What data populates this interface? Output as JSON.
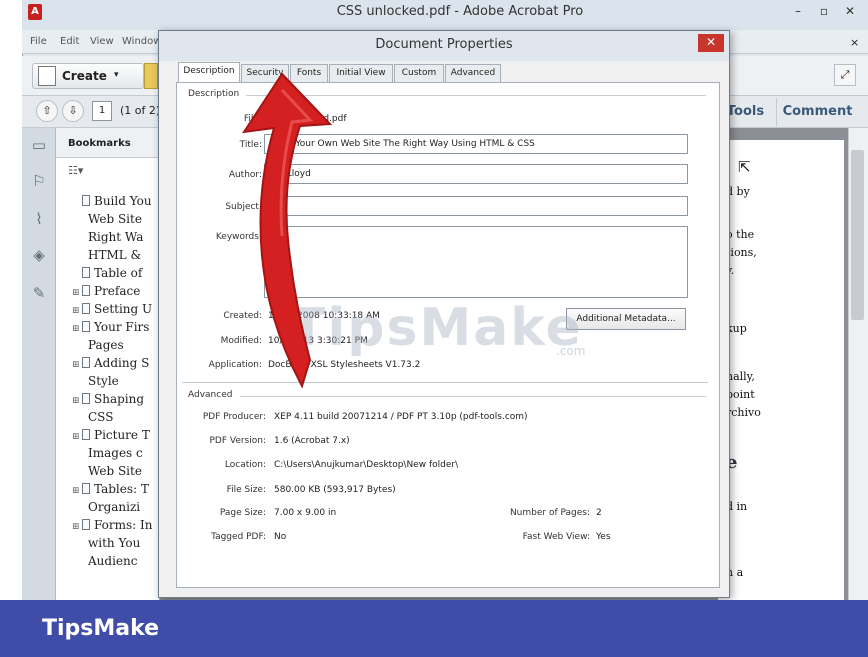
{
  "app": {
    "title": "CSS unlocked.pdf - Adobe Acrobat Pro",
    "menu": [
      "File",
      "Edit",
      "View",
      "Window"
    ],
    "create_label": "Create",
    "page_counter": "(1 of 2)",
    "tools_label": "Tools",
    "comment_label": "Comment",
    "bookmarks_title": "Bookmarks",
    "bookmarks": [
      {
        "label": "Build You",
        "expand": ""
      },
      {
        "label": "Web Site",
        "expand": "",
        "cont": true
      },
      {
        "label": "Right Wa",
        "expand": "",
        "cont": true
      },
      {
        "label": "HTML &",
        "expand": "",
        "cont": true
      },
      {
        "label": "Table of",
        "expand": ""
      },
      {
        "label": "Preface",
        "expand": "⊞"
      },
      {
        "label": "Setting U",
        "expand": "⊞"
      },
      {
        "label": "Your Firs",
        "expand": "⊞"
      },
      {
        "label": "Pages",
        "expand": "",
        "cont": true
      },
      {
        "label": "Adding S",
        "expand": "⊞"
      },
      {
        "label": "Style",
        "expand": "",
        "cont": true
      },
      {
        "label": "Shaping",
        "expand": "⊞"
      },
      {
        "label": "CSS",
        "expand": "",
        "cont": true
      },
      {
        "label": "Picture T",
        "expand": "⊞"
      },
      {
        "label": "Images c",
        "expand": "",
        "cont": true
      },
      {
        "label": "Web Site",
        "expand": "",
        "cont": true
      },
      {
        "label": "Tables: T",
        "expand": "⊞"
      },
      {
        "label": "Organizi",
        "expand": "",
        "cont": true
      },
      {
        "label": "Forms: In",
        "expand": "⊞"
      },
      {
        "label": "with You",
        "expand": "",
        "cont": true
      },
      {
        "label": "Audienc",
        "expand": "",
        "cont": true
      }
    ],
    "doc_fragments": [
      {
        "text": "d by",
        "row": 0
      },
      {
        "text": "o the",
        "row": 1
      },
      {
        "text": "tions,",
        "row": 2
      },
      {
        "text": "y.",
        "row": 3
      },
      {
        "text": "kup",
        "row": 4
      },
      {
        "text": "nally,",
        "row": 5
      },
      {
        "text": "point",
        "row": 6
      },
      {
        "text": "rchivo",
        "row": 7
      },
      {
        "text": "e",
        "row": 8
      },
      {
        "text": "d in",
        "row": 9
      },
      {
        "text": "n a",
        "row": 10
      }
    ]
  },
  "dialog": {
    "title": "Document Properties",
    "close_label": "✕",
    "tabs": [
      "Description",
      "Security",
      "Fonts",
      "Initial View",
      "Custom",
      "Advanced"
    ],
    "description_section": "Description",
    "file_label": "File:",
    "file_value": "CSS unlocked.pdf",
    "title_label": "Title:",
    "title_value": "Build Your Own Web Site The Right Way Using HTML & CSS",
    "author_label": "Author:",
    "author_value": "Ian Lloyd",
    "subject_label": "Subject:",
    "subject_value": "",
    "keywords_label": "Keywords:",
    "keywords_value": "",
    "created_label": "Created:",
    "created_value": "10/21/2008 10:33:18 AM",
    "modified_label": "Modified:",
    "modified_value": "10/5/2013 3:30:21 PM",
    "application_label": "Application:",
    "application_value": "DocBook XSL Stylesheets V1.73.2",
    "metadata_button": "Additional Metadata...",
    "advanced_section": "Advanced",
    "producer_label": "PDF Producer:",
    "producer_value": "XEP 4.11 build 20071214 / PDF PT 3.10p (pdf-tools.com)",
    "version_label": "PDF Version:",
    "version_value": "1.6 (Acrobat 7.x)",
    "location_label": "Location:",
    "location_value": "C:\\Users\\Anujkumar\\Desktop\\New folder\\",
    "filesize_label": "File Size:",
    "filesize_value": "580.00 KB (593,917 Bytes)",
    "pagesize_label": "Page Size:",
    "pagesize_value": "7.00 x 9.00 in",
    "numpages_label": "Number of Pages:",
    "numpages_value": "2",
    "tagged_label": "Tagged PDF:",
    "tagged_value": "No",
    "fastweb_label": "Fast Web View:",
    "fastweb_value": "Yes"
  },
  "watermark": {
    "text": "TipsMake",
    "suffix": ".com"
  },
  "brand": {
    "name": "TipsMake",
    "band_color": "#3f4ca8"
  },
  "colors": {
    "arrow": "#d42020",
    "close_button": "#c8362b"
  }
}
